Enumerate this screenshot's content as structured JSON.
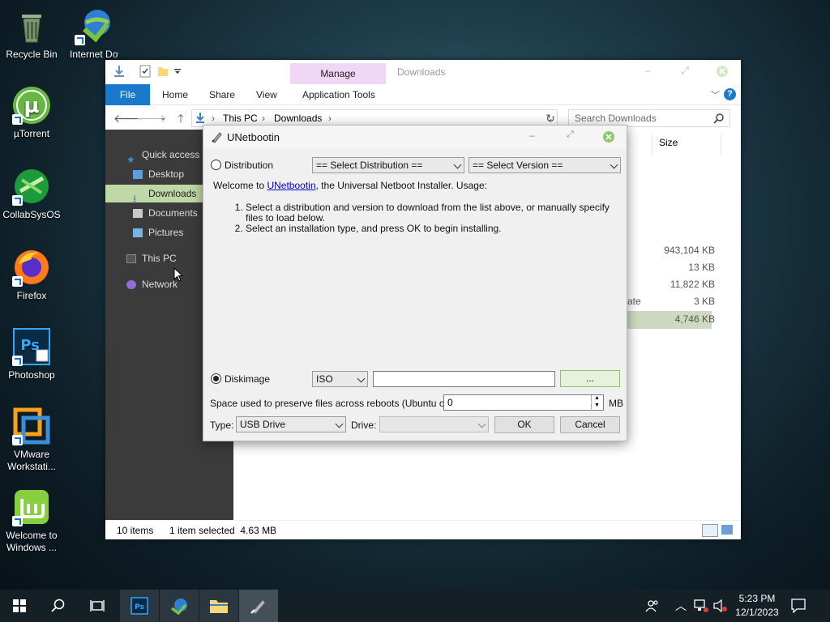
{
  "desktop": {
    "icons": [
      {
        "label": "Recycle Bin"
      },
      {
        "label": "Internet Downl..."
      },
      {
        "label": "µTorrent"
      },
      {
        "label": "CollabSysOS"
      },
      {
        "label": "Firefox"
      },
      {
        "label": "Photoshop"
      },
      {
        "label": "VMware Workstati..."
      },
      {
        "label": "Welcome to Windows ..."
      }
    ]
  },
  "explorer": {
    "context_tab": "Manage",
    "title": "Downloads",
    "ribbon_tabs": [
      "File",
      "Home",
      "Share",
      "View",
      "Application Tools"
    ],
    "breadcrumb": [
      "This PC",
      "Downloads"
    ],
    "search_placeholder": "Search Downloads",
    "nav_items": [
      "Quick access",
      "Desktop",
      "Downloads",
      "Documents",
      "Pictures",
      "This PC",
      "Network"
    ],
    "column_size": "Size",
    "sizes": [
      "943,104 KB",
      "13 KB",
      "11,822 KB",
      "3 KB",
      "4,746 KB"
    ],
    "partial_type": "ate",
    "status_items": "10 items",
    "status_selected": "1 item selected  4.63 MB"
  },
  "unetbootin": {
    "title": "UNetbootin",
    "distribution_label": "Distribution",
    "select_distribution": "== Select Distribution ==",
    "select_version": "== Select Version ==",
    "welcome_pre": "Welcome to ",
    "welcome_link": "UNetbootin",
    "welcome_post": ", the Universal Netboot Installer. Usage:",
    "steps": [
      "Select a distribution and version to download from the list above, or manually specify files to load below.",
      "Select an installation type, and press OK to begin installing."
    ],
    "diskimage_label": "Diskimage",
    "diskimage_type": "ISO",
    "diskimage_path": "",
    "browse_label": "...",
    "space_label": "Space used to preserve files across reboots (Ubuntu only):",
    "space_value": "0",
    "space_unit": "MB",
    "type_label": "Type:",
    "type_value": "USB Drive",
    "drive_label": "Drive:",
    "drive_value": "",
    "ok_label": "OK",
    "cancel_label": "Cancel"
  },
  "taskbar": {
    "time": "5:23 PM",
    "date": "12/1/2023"
  },
  "colors": {
    "accent": "#1979ca",
    "manage_tab": "#f1d7f6",
    "nav_selected": "#c0d8a5",
    "taskbar": "#151f26"
  }
}
